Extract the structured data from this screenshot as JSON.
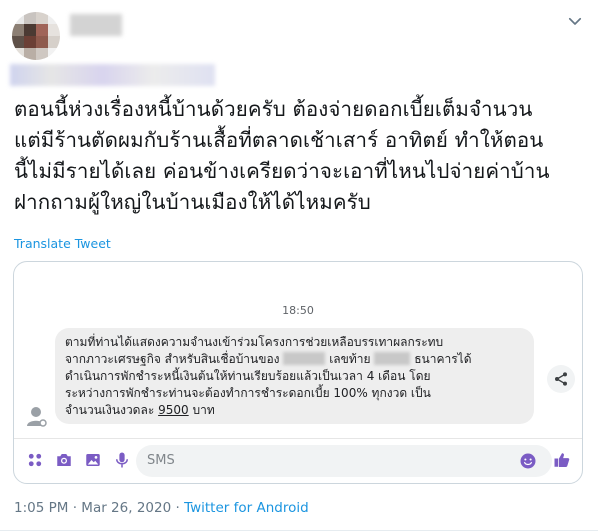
{
  "tweet": {
    "text_lines": [
      "ตอนนี้ห่วงเรื่องหนี้บ้านด้วยครับ ต้องจ่ายดอกเบี้ยเต็มจำนวน",
      "แต่มีร้านตัดผมกับร้านเสื้อที่ตลาดเช้าเสาร์ อาทิตย์ ทำให้ตอน",
      "นี้ไม่มีรายได้เลย ค่อนข้างเครียดว่าจะเอาที่ไหนไปจ่ายค่าบ้าน",
      "ฝากถามผู้ใหญ่ในบ้านเมืองให้ได้ไหมครับ"
    ],
    "translate_label": "Translate Tweet",
    "time": "1:05 PM",
    "separator": "·",
    "date": "Mar 26, 2020",
    "source": "Twitter for Android"
  },
  "embedded_sms": {
    "timestamp": "18:50",
    "message": {
      "line1": "ตามที่ท่านได้แสดงความจำนงเข้าร่วมโครงการช่วยเหลือบรรเทาผลกระทบ",
      "line2_a": "จากภาวะเศรษฐกิจ สำหรับสินเชื่อบ้านของ",
      "line2_b": "เลขท้าย",
      "line2_c": "ธนาคารได้",
      "line3": "ดำเนินการพักชำระหนี้เงินต้นให้ท่านเรียบร้อยแล้วเป็นเวลา 4 เดือน โดย",
      "line4": "ระหว่างการพักชำระท่านจะต้องทำการชำระดอกเบี้ย 100% ทุกงวด เป็น",
      "line5_a": "จำนวนเงินงวดละ",
      "line5_amount": "9500",
      "line5_b": "บาท"
    },
    "input_placeholder": "SMS"
  },
  "colors": {
    "link_blue": "#1b95e0",
    "meta_gray": "#657786",
    "accent_purple": "#7b5cc4"
  },
  "icons": [
    "chevron-down-icon",
    "contact-avatar-icon",
    "share-icon",
    "apps-icon",
    "camera-icon",
    "gallery-icon",
    "microphone-icon",
    "emoji-icon",
    "thumbs-up-icon"
  ]
}
